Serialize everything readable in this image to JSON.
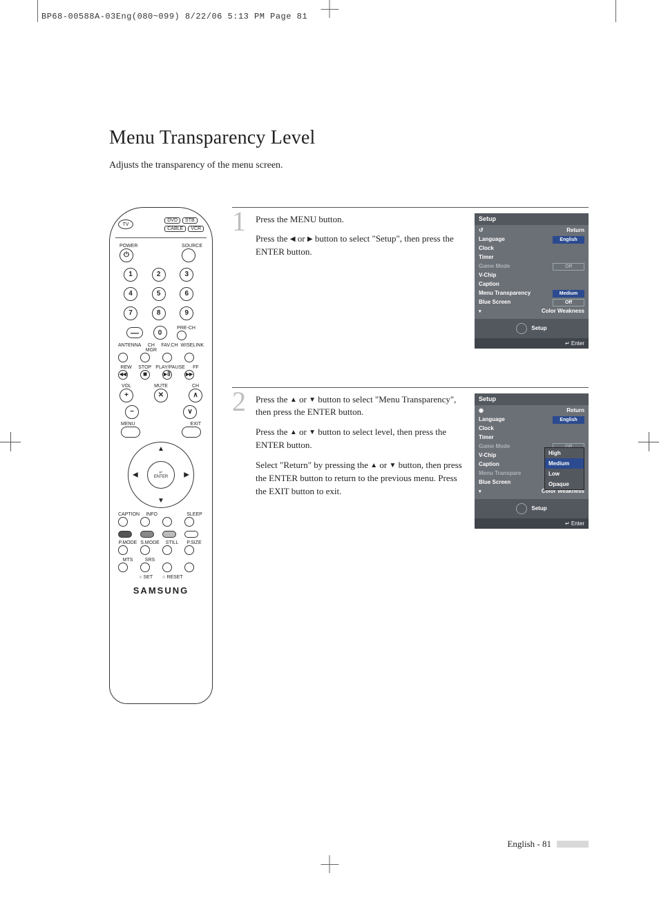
{
  "slug": "BP68-00588A-03Eng(080~099)  8/22/06  5:13 PM  Page 81",
  "title": "Menu Transparency Level",
  "intro": "Adjusts the transparency of the menu screen.",
  "remote": {
    "source_buttons": {
      "tv": "TV",
      "dvd": "DVD",
      "stb": "STB",
      "cable": "CABLE",
      "vcr": "VCR"
    },
    "power": "POWER",
    "source": "SOURCE",
    "keypad": [
      "1",
      "2",
      "3",
      "4",
      "5",
      "6",
      "7",
      "8",
      "9"
    ],
    "dash": "—",
    "zero": "0",
    "prech": "PRE-CH",
    "row_labels_a": [
      "ANTENNA",
      "CH MGR",
      "FAV.CH",
      "WISELINK"
    ],
    "row_labels_b": [
      "REW",
      "STOP",
      "PLAY/PAUSE",
      "FF"
    ],
    "transport": [
      "◂◂",
      "■",
      "▸‖",
      "▸▸"
    ],
    "vol": "VOL",
    "ch": "CH",
    "mute": "MUTE",
    "menu": "MENU",
    "exit": "EXIT",
    "enter": "ENTER",
    "row_labels_c": [
      "CAPTION",
      "INFO",
      "",
      "SLEEP"
    ],
    "row_labels_d": [
      "P.MODE",
      "S.MODE",
      "STILL",
      "P.SIZE"
    ],
    "row_labels_e": [
      "MTS",
      "SRS",
      "",
      ""
    ],
    "set_reset": [
      "SET",
      "RESET"
    ],
    "brand": "SAMSUNG"
  },
  "steps": [
    {
      "num": "1",
      "paragraphs": [
        "Press the MENU button.",
        "Press the ◀ or ▶ button to select \"Setup\", then press the ENTER button."
      ],
      "osd": {
        "title": "Setup",
        "return_style": "arrow",
        "rows": [
          {
            "k": "Return",
            "v": "",
            "type": "return"
          },
          {
            "k": "Language",
            "v": "English",
            "sel": true
          },
          {
            "k": "Clock",
            "v": ""
          },
          {
            "k": "Timer",
            "v": ""
          },
          {
            "k": "Game Mode",
            "v": "Off",
            "dim": true
          },
          {
            "k": "V-Chip",
            "v": ""
          },
          {
            "k": "Caption",
            "v": ""
          },
          {
            "k": "Menu Transparency",
            "v": "Medium",
            "sel": true
          },
          {
            "k": "Blue Screen",
            "v": "Off"
          },
          {
            "k": "Color Weakness",
            "v": "",
            "type": "more"
          }
        ],
        "band": "Setup",
        "foot_icon": "↵",
        "foot": "Enter",
        "popup": null
      }
    },
    {
      "num": "2",
      "paragraphs": [
        "Press the ▲ or ▼ button to select \"Menu Transparency\", then press the ENTER button.",
        "Press the ▲ or ▼ button to select level, then press the ENTER button.",
        "Select \"Return\" by pressing the ▲ or ▼ button, then press the ENTER button to return to the previous menu. Press the EXIT button to exit."
      ],
      "osd": {
        "title": "Setup",
        "return_style": "dot",
        "rows": [
          {
            "k": "Return",
            "v": "",
            "type": "return"
          },
          {
            "k": "Language",
            "v": "English",
            "sel": true
          },
          {
            "k": "Clock",
            "v": ""
          },
          {
            "k": "Timer",
            "v": ""
          },
          {
            "k": "Game Mode",
            "v": "Off",
            "dim": true
          },
          {
            "k": "V-Chip",
            "v": ""
          },
          {
            "k": "Caption",
            "v": ""
          },
          {
            "k": "Menu Transpare",
            "v": "",
            "dim": true
          },
          {
            "k": "Blue Screen",
            "v": ""
          },
          {
            "k": "Color Weakness",
            "v": "",
            "type": "more"
          }
        ],
        "band": "Setup",
        "foot_icon": "↵",
        "foot": "Enter",
        "popup": {
          "items": [
            "High",
            "Medium",
            "Low",
            "Opaque"
          ],
          "selected": 1
        }
      }
    }
  ],
  "footer": "English - 81"
}
